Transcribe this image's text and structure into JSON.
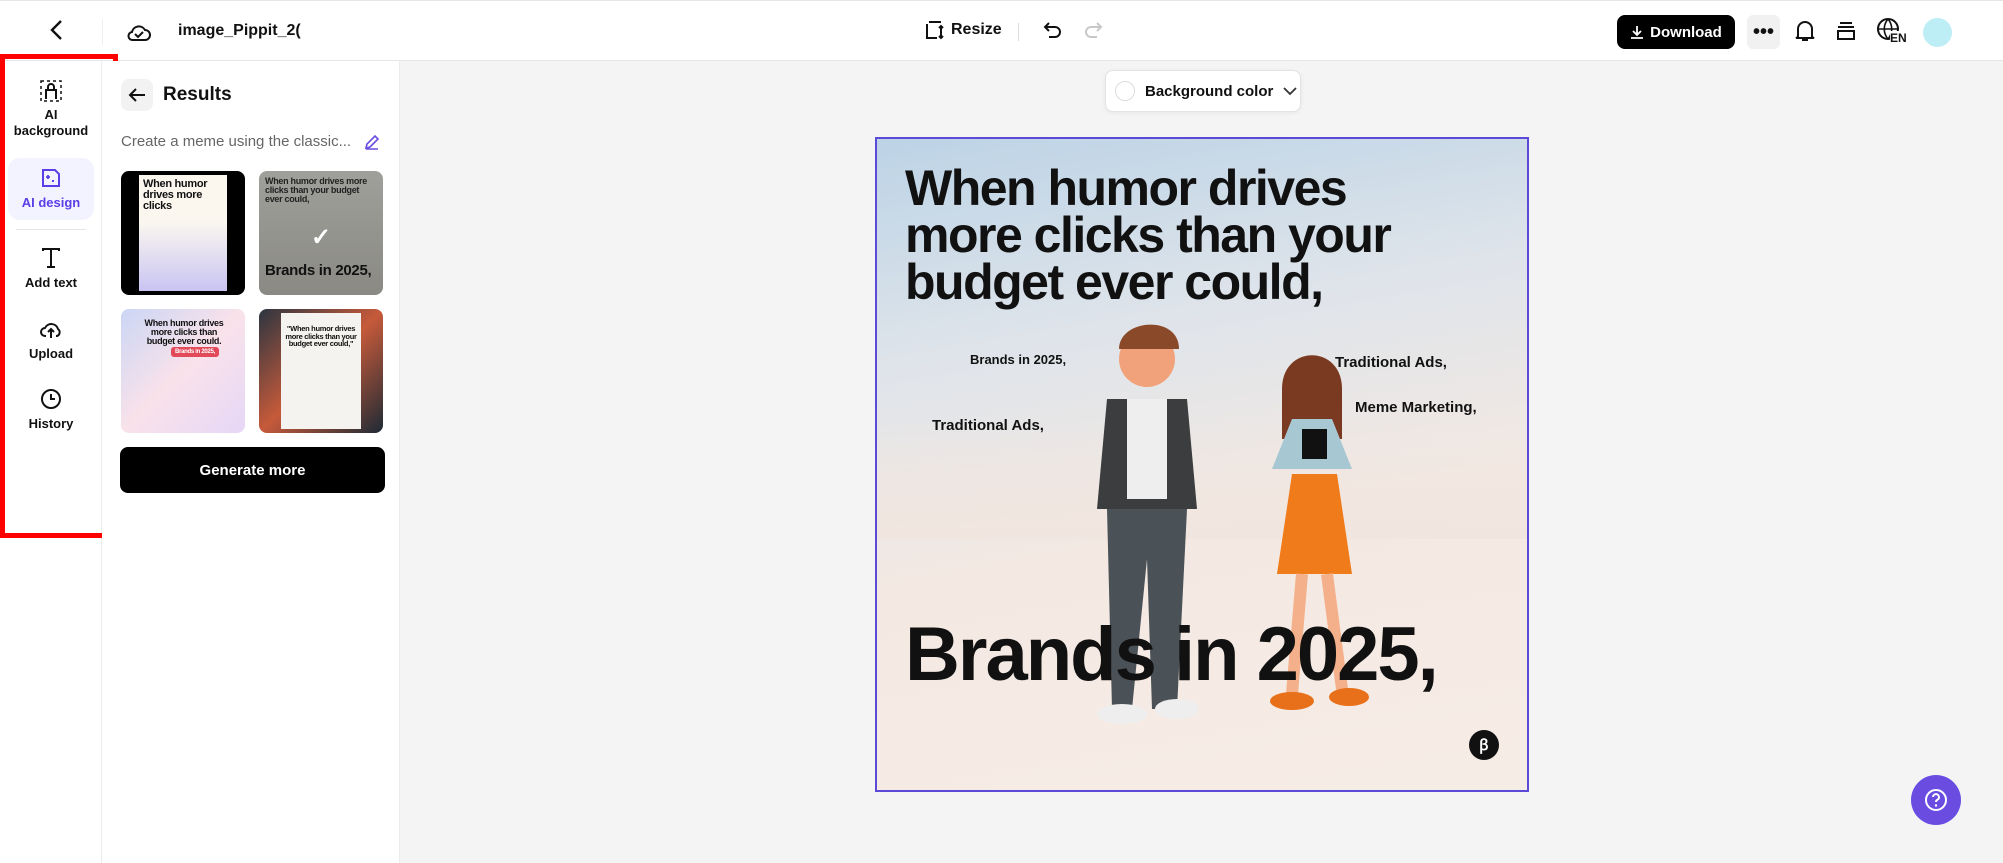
{
  "header": {
    "file_name": "image_Pippit_2(",
    "resize_label": "Resize",
    "download_label": "Download",
    "language": "EN"
  },
  "rail": {
    "items": [
      {
        "label": "AI background",
        "icon": "ai-background-icon"
      },
      {
        "label": "AI design",
        "icon": "ai-design-icon",
        "active": true
      },
      {
        "label": "Add text",
        "icon": "text-icon"
      },
      {
        "label": "Upload",
        "icon": "upload-cloud-icon"
      },
      {
        "label": "History",
        "icon": "clock-icon"
      }
    ]
  },
  "panel": {
    "title": "Results",
    "prompt": "Create a meme using the classic...",
    "generate_label": "Generate more",
    "thumbs": [
      {
        "text": "When humor drives more clicks"
      },
      {
        "text": "When humor drives more clicks than your budget ever could,",
        "sub": "Brands in 2025,",
        "selected": true
      },
      {
        "text": "When humor drives more clicks than budget ever could.",
        "sub": "Brands in 2025,"
      },
      {
        "text": "\"When humor drives more clicks than your budget ever could,\""
      }
    ]
  },
  "canvas_toolbar": {
    "background_color_label": "Background color"
  },
  "canvas": {
    "headline": "When humor drives more clicks than your budget ever could,",
    "bottom": "Brands in 2025,",
    "labels": [
      "Brands in 2025,",
      "Traditional Ads,",
      "Traditional Ads,",
      "Meme Marketing,"
    ]
  },
  "colors": {
    "accent": "#5b3ee8",
    "highlight": "#ff0000",
    "help_button": "#6a4ce0"
  }
}
